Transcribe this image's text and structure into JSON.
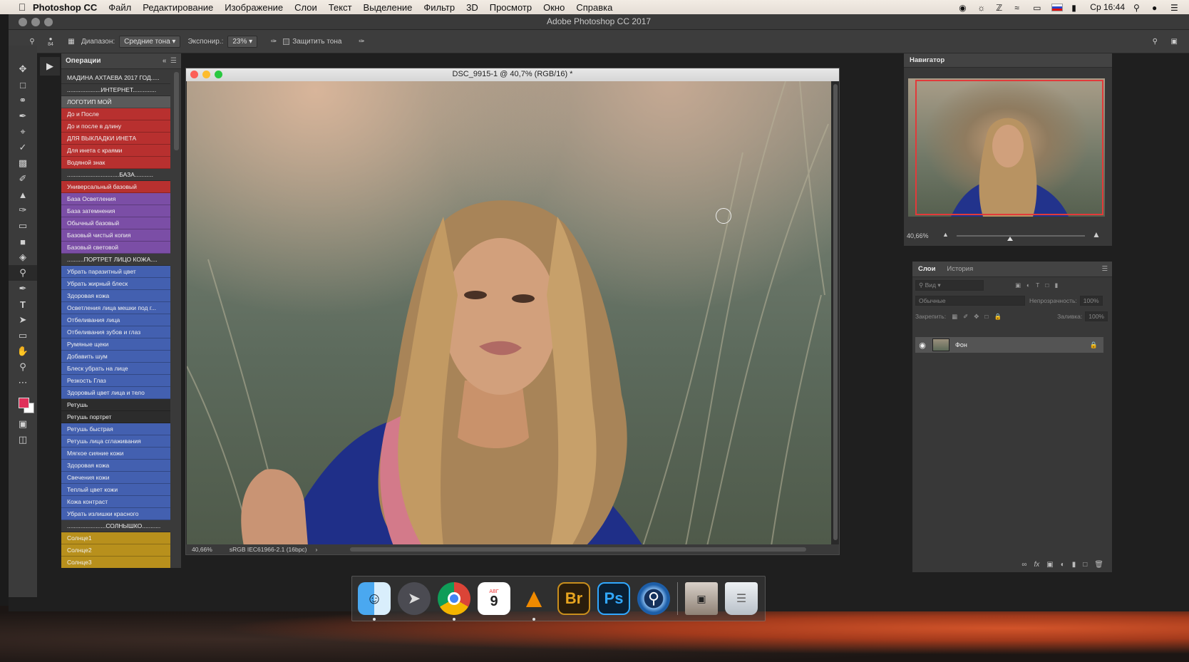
{
  "menubar": {
    "app": "Photoshop CC",
    "items": [
      "Файл",
      "Редактирование",
      "Изображение",
      "Слои",
      "Текст",
      "Выделение",
      "Фильтр",
      "3D",
      "Просмотр",
      "Окно",
      "Справка"
    ],
    "clock": "Ср 16:44"
  },
  "window": {
    "title": "Adobe Photoshop CC 2017"
  },
  "options": {
    "brush_size": "84",
    "range_label": "Диапазон:",
    "range_value": "Средние тона",
    "exposure_label": "Экспонир.:",
    "exposure_value": "23%",
    "protect_label": "Защитить тона"
  },
  "actions": {
    "title": "Операции",
    "rows": [
      {
        "label": "МАДИНА АХТАЕВА 2017  ГОД.....",
        "color": "#3a3a3a"
      },
      {
        "label": "....................ИНТЕРНЕТ..............",
        "color": "#3a3a3a"
      },
      {
        "label": "ЛОГОТИП МОЙ",
        "color": "#5a5a5a"
      },
      {
        "label": "До и После",
        "color": "#b8302f"
      },
      {
        "label": "До и после в длину",
        "color": "#b8302f"
      },
      {
        "label": "ДЛЯ ВЫКЛАДКИ ИНЕТА",
        "color": "#b8302f"
      },
      {
        "label": "Для инета с краями",
        "color": "#b8302f"
      },
      {
        "label": "Водяной знак",
        "color": "#b8302f"
      },
      {
        "label": "...............................БАЗА...........",
        "color": "#3a3a3a"
      },
      {
        "label": "Универсальный базовый",
        "color": "#b8302f"
      },
      {
        "label": "База Осветления",
        "color": "#7b4ea6"
      },
      {
        "label": "База затемнения",
        "color": "#7b4ea6"
      },
      {
        "label": "Обычный базовый",
        "color": "#7b4ea6"
      },
      {
        "label": "Базовый чистый копия",
        "color": "#7b4ea6"
      },
      {
        "label": "Базовый световой",
        "color": "#7b4ea6"
      },
      {
        "label": "..........ПОРТРЕТ ЛИЦО КОЖА....",
        "color": "#3a3a3a"
      },
      {
        "label": "Убрать паразитный цвет",
        "color": "#4360b0"
      },
      {
        "label": "Убрать жирный блеск",
        "color": "#4360b0"
      },
      {
        "label": "Здоровая кожа",
        "color": "#4360b0"
      },
      {
        "label": "Осветления лица мешки под г...",
        "color": "#4360b0"
      },
      {
        "label": "Отбеливания лица",
        "color": "#4360b0"
      },
      {
        "label": "Отбеливания зубов и глаз",
        "color": "#4360b0"
      },
      {
        "label": "Румяные щеки",
        "color": "#4360b0"
      },
      {
        "label": "Добавить шум",
        "color": "#4360b0"
      },
      {
        "label": "Блеск убрать на лице",
        "color": "#4360b0"
      },
      {
        "label": "Резкость Глаз",
        "color": "#4360b0"
      },
      {
        "label": "Здоровый цвет лица и тело",
        "color": "#4360b0"
      },
      {
        "label": "Ретушь",
        "color": "#2c2c2c"
      },
      {
        "label": "Ретушь портрет",
        "color": "#2c2c2c"
      },
      {
        "label": "Ретушь быстрая",
        "color": "#4360b0"
      },
      {
        "label": "Ретушь лица сглаживания",
        "color": "#4360b0"
      },
      {
        "label": "Мягкое сияние кожи",
        "color": "#4360b0"
      },
      {
        "label": "Здоровая кожа",
        "color": "#4360b0"
      },
      {
        "label": "Свечения кожи",
        "color": "#4360b0"
      },
      {
        "label": "Теплый цвет кожи",
        "color": "#4360b0"
      },
      {
        "label": "Кожа  контраст",
        "color": "#4360b0"
      },
      {
        "label": "Убрать излишки красного",
        "color": "#4360b0"
      },
      {
        "label": ".......................СОЛНЫШКО...........",
        "color": "#3a3a3a"
      },
      {
        "label": "Солнце1",
        "color": "#b8901c"
      },
      {
        "label": "Солнце2",
        "color": "#b8901c"
      },
      {
        "label": "Солнце3",
        "color": "#b8901c"
      }
    ]
  },
  "document": {
    "title": "DSC_9915-1 @ 40,7% (RGB/16) *",
    "zoom": "40,66%",
    "profile": "sRGB IEC61966-2.1 (16bpc)"
  },
  "navigator": {
    "title": "Навигатор",
    "zoom": "40,66%"
  },
  "layers": {
    "tab_layers": "Слои",
    "tab_history": "История",
    "search_placeholder": "Вид",
    "blend_mode": "Обычные",
    "opacity_label": "Непрозрачность:",
    "opacity_value": "100%",
    "lock_label": "Закрепить:",
    "fill_label": "Заливка:",
    "fill_value": "100%",
    "layer_name": "Фон"
  },
  "dock": {
    "bridge": "Br",
    "photoshop": "Ps",
    "calendar_month": "АВГ",
    "calendar_day": "9"
  },
  "colors": {
    "foreground": "#e0305a",
    "background": "#ffffff",
    "nav_frame": "#e23a3a"
  }
}
